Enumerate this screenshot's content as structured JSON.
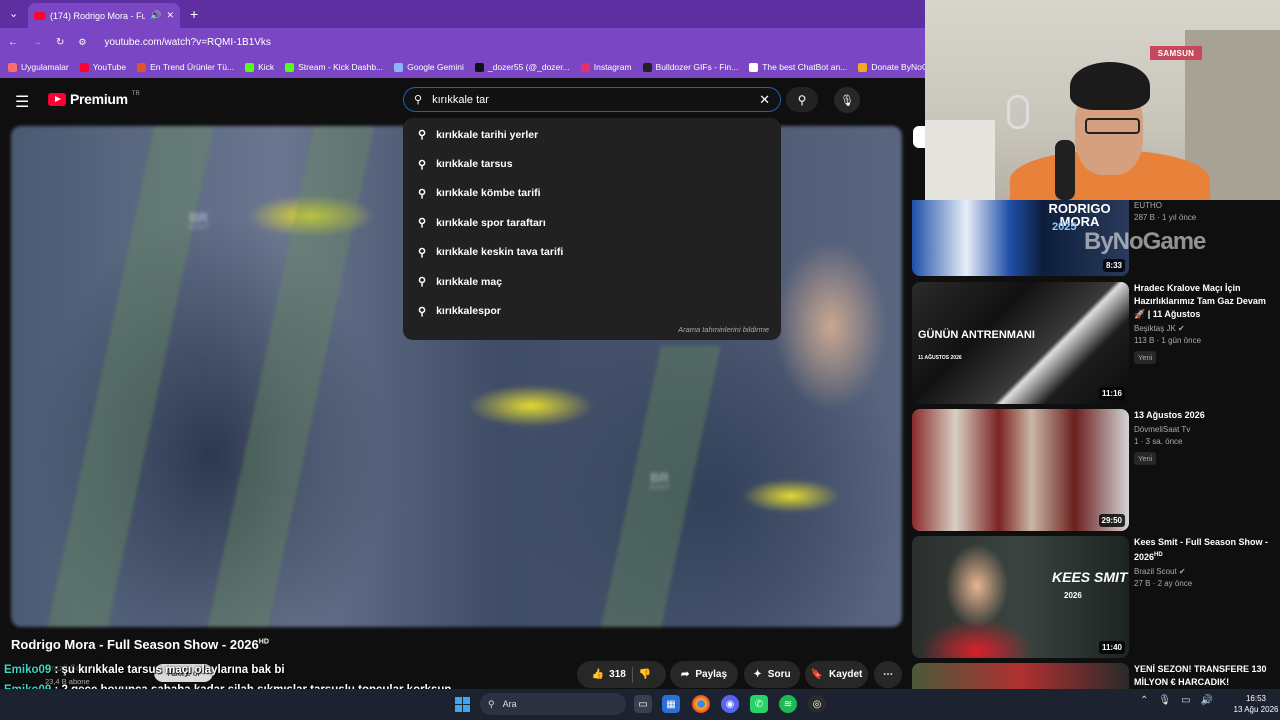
{
  "browser": {
    "tab_title": "(174) Rodrigo Mora - Full S",
    "url": "youtube.com/watch?v=RQMI-1B1Vks",
    "bookmarks": [
      {
        "label": "Uygulamalar",
        "color": "#ff6b6b"
      },
      {
        "label": "YouTube",
        "color": "#ff0033"
      },
      {
        "label": "En Trend Ürünler Tü...",
        "color": "#e0542a"
      },
      {
        "label": "Kick",
        "color": "#53fc18"
      },
      {
        "label": "Stream - Kick Dashb...",
        "color": "#53fc18"
      },
      {
        "label": "Google Gemini",
        "color": "#8ab4f8"
      },
      {
        "label": "_dozer55 (@_dozer...",
        "color": "#111111"
      },
      {
        "label": "Instagram",
        "color": "#e1306c"
      },
      {
        "label": "Bulldozer GIFs - Fin...",
        "color": "#222222"
      },
      {
        "label": "The best ChatBot an...",
        "color": "#ffffff"
      },
      {
        "label": "Donate ByNoGame...",
        "color": "#f5a623"
      }
    ]
  },
  "youtube": {
    "logo_text": "Premium",
    "logo_region": "TR",
    "search_query": "kırıkkale tar",
    "suggestions": [
      "kırıkkale tarihi yerler",
      "kırıkkale tarsus",
      "kırıkkale kömbe tarifi",
      "kırıkkale spor taraftarı",
      "kırıkkale keskin tava tarifi",
      "kırıkkale maç",
      "kırıkkalespor"
    ],
    "suggestions_footer": "Arama tahminlerini bildirme"
  },
  "player": {
    "watermark": "BR",
    "watermark_sub": "SCOUT"
  },
  "video": {
    "title": "Rodrigo Mora - Full Season Show - 2026",
    "quality_badge": "HD",
    "channel_ghost": "Brazil Scout",
    "subscribers": "23,4 B abone",
    "subscribe_label": "Abone ol",
    "likes": "318",
    "share_label": "Paylaş",
    "ask_label": "Soru",
    "save_label": "Kaydet"
  },
  "chat": [
    {
      "user": "Emiko09",
      "message": " : şu kırıkkale tarsus maçı olaylarına bak bi"
    },
    {
      "user": "Emiko09",
      "message": " : 2 gece boyunca sabaha kadar silah sıkmışlar tarsuslu topçular korksun diye"
    }
  ],
  "sidebar": [
    {
      "title": "",
      "channel": "EUTHO",
      "meta": "287 B · 1 yıl önce",
      "duration": "8:33",
      "thumb_text": "RODRIGO MORA",
      "thumb_sub": "2025",
      "overlay": "ByNoGame",
      "new": ""
    },
    {
      "title": "Hradec Kralove Maçı İçin Hazırlıklarımız Tam Gaz Devam 🚀 | 11 Ağustos",
      "channel": "Beşiktaş JK",
      "meta": "113 B · 1 gün önce",
      "duration": "11:16",
      "thumb_text": "GÜNÜN ANTRENMANI",
      "thumb_sub": "11 AĞUSTOS 2026",
      "overlay": "",
      "new": "Yeni"
    },
    {
      "title": "13 Ağustos 2026",
      "channel": "DövmeliSaat Tv",
      "meta": "1 · 3 sa. önce",
      "duration": "29:50",
      "thumb_text": "",
      "thumb_sub": "",
      "overlay": "",
      "new": "Yeni"
    },
    {
      "title": "Kees Smit - Full Season Show - 2026",
      "channel": "Brazil Scout",
      "meta": "27 B · 2 ay önce",
      "duration": "11:40",
      "thumb_text": "KEES SMIT",
      "thumb_sub": "2026",
      "overlay": "",
      "new": ""
    },
    {
      "title": "YENİ SEZON! TRANSFERE 130 MİLYON € HARCADIK!",
      "channel": "",
      "meta": "",
      "duration": "",
      "thumb_text": "",
      "thumb_sub": "",
      "overlay": "",
      "new": ""
    }
  ],
  "webcam": {
    "sign": "SAMSUN"
  },
  "taskbar": {
    "search_placeholder": "Ara",
    "time": "16:53",
    "date": "13 Ağu 2026"
  }
}
